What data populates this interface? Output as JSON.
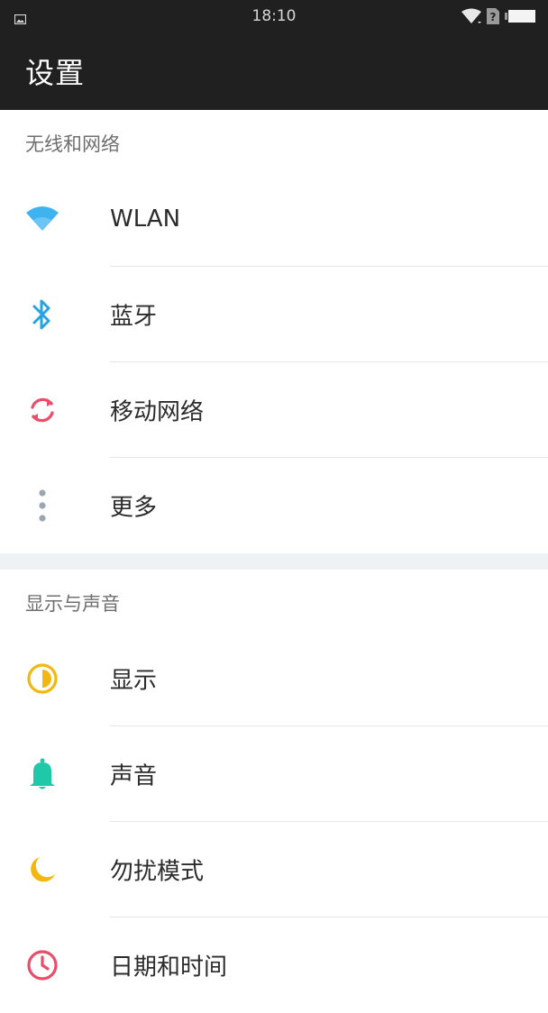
{
  "status_bar": {
    "time": "18:10",
    "icons": [
      "image-notification-icon",
      "wifi-icon",
      "no-sim-icon",
      "battery-icon"
    ]
  },
  "app_bar": {
    "title": "设置"
  },
  "sections": [
    {
      "header": "无线和网络",
      "items": [
        {
          "label": "WLAN",
          "icon": "wifi-icon",
          "color": "#3fb3f0"
        },
        {
          "label": "蓝牙",
          "icon": "bluetooth-icon",
          "color": "#27a3e4"
        },
        {
          "label": "移动网络",
          "icon": "mobile-data-icon",
          "color": "#ea4e6a"
        },
        {
          "label": "更多",
          "icon": "more-vertical-icon",
          "color": "#9aa6b2"
        }
      ]
    },
    {
      "header": "显示与声音",
      "items": [
        {
          "label": "显示",
          "icon": "display-brightness-icon",
          "color": "#f2b80f"
        },
        {
          "label": "声音",
          "icon": "bell-icon",
          "color": "#1fc9a8"
        },
        {
          "label": "勿扰模式",
          "icon": "moon-icon",
          "color": "#f2b80f"
        },
        {
          "label": "日期和时间",
          "icon": "clock-icon",
          "color": "#e84e69"
        }
      ]
    }
  ]
}
